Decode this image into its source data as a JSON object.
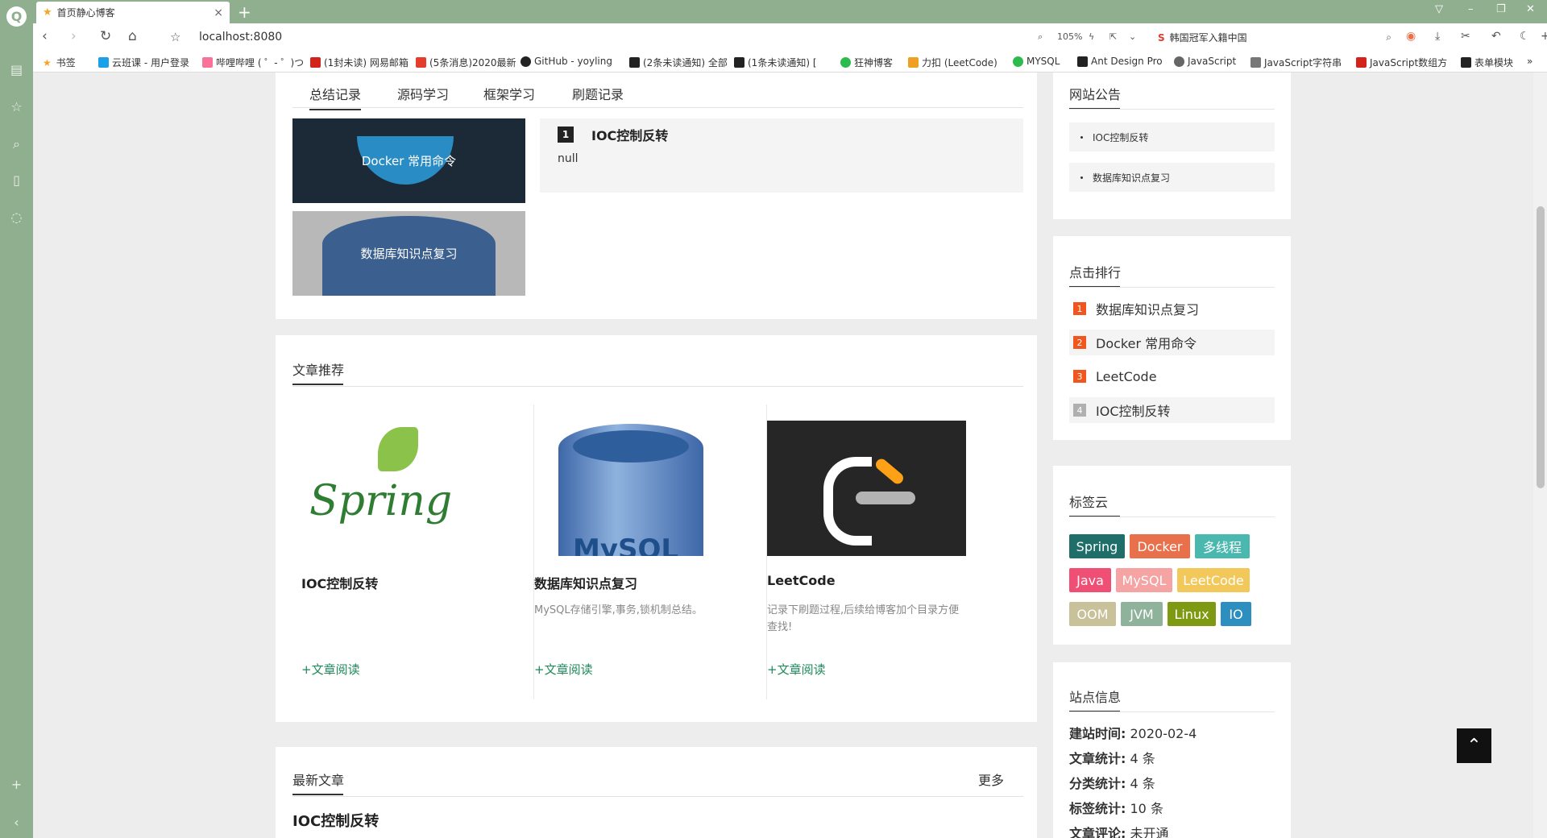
{
  "browser": {
    "tab_title": "首页静心博客",
    "url": "localhost:8080",
    "zoom": "105%",
    "search_text": "韩国冠军入籍中国",
    "bookmarks": [
      "书签",
      "云班课 - 用户登录",
      "哔哩哔哩 ( ゜- ゜)つ",
      "(1封未读) 网易邮箱",
      "(5条消息)2020最新",
      "GitHub - yoyling",
      "(2条未读通知) 全部",
      "(1条未读通知) [",
      "狂神博客",
      "力扣 (LeetCode)",
      "MYSQL",
      "Ant Design Pro",
      "JavaScript",
      "JavaScript字符串",
      "JavaScript数组方",
      "表单模块"
    ]
  },
  "top_panel": {
    "tabs": [
      "总结记录",
      "源码学习",
      "框架学习",
      "刷题记录"
    ],
    "thumbs": [
      "Docker 常用命令",
      "数据库知识点复习"
    ],
    "feature": {
      "num": "1",
      "title": "IOC控制反转",
      "body": "null"
    }
  },
  "recommend": {
    "title": "文章推荐",
    "cards": [
      {
        "title": "IOC控制反转",
        "desc": "",
        "link": "+文章阅读",
        "img_text": "Spring"
      },
      {
        "title": "数据库知识点复习",
        "desc": "MySQL存储引擎,事务,锁机制总结。",
        "link": "+文章阅读",
        "img_text": "MySQL"
      },
      {
        "title": "LeetCode",
        "desc": "记录下刷题过程,后续给博客加个目录方便查找!",
        "link": "+文章阅读",
        "img_text": ""
      }
    ]
  },
  "latest": {
    "title": "最新文章",
    "more": "更多",
    "first": "IOC控制反转"
  },
  "notice": {
    "title": "网站公告",
    "items": [
      "IOC控制反转",
      "数据库知识点复习"
    ]
  },
  "ranking": {
    "title": "点击排行",
    "items": [
      {
        "num": "1",
        "label": "数据库知识点复习",
        "color": "#f0561d"
      },
      {
        "num": "2",
        "label": "Docker 常用命令",
        "color": "#f0561d"
      },
      {
        "num": "3",
        "label": "LeetCode",
        "color": "#f0561d"
      },
      {
        "num": "4",
        "label": "IOC控制反转",
        "color": "#b0b0b0"
      }
    ]
  },
  "tags": {
    "title": "标签云",
    "items": [
      {
        "label": "Spring",
        "color": "#1f6e6a"
      },
      {
        "label": "Docker",
        "color": "#e8704a"
      },
      {
        "label": "多线程",
        "color": "#4bb8b0"
      },
      {
        "label": "Java",
        "color": "#ef4f74"
      },
      {
        "label": "MySQL",
        "color": "#f5a3a3"
      },
      {
        "label": "LeetCode",
        "color": "#f2c85a"
      },
      {
        "label": "OOM",
        "color": "#c9c19a"
      },
      {
        "label": "JVM",
        "color": "#8fb39a"
      },
      {
        "label": "Linux",
        "color": "#7e9a12"
      },
      {
        "label": "IO",
        "color": "#2d8fbf"
      }
    ]
  },
  "site_info": {
    "title": "站点信息",
    "rows": [
      {
        "k": "建站时间:",
        "v": "2020-02-4"
      },
      {
        "k": "文章统计:",
        "v": "4 条"
      },
      {
        "k": "分类统计:",
        "v": "4 条"
      },
      {
        "k": "标签统计:",
        "v": "10 条"
      },
      {
        "k": "文章评论:",
        "v": "未开通"
      }
    ]
  }
}
